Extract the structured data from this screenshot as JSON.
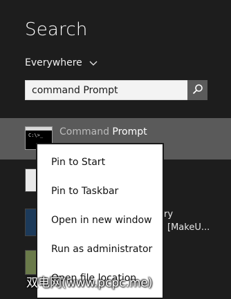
{
  "header": {
    "title": "Search"
  },
  "scope": {
    "label": "Everywhere"
  },
  "search": {
    "value": "command Prompt"
  },
  "results": {
    "first": {
      "prefix": "Command ",
      "match": "Prompt",
      "icon_text": "C:\\>_"
    },
    "partial_right": [
      "ry",
      "[MakeU..."
    ]
  },
  "context_menu": {
    "items": [
      "Pin to Start",
      "Pin to Taskbar",
      "Open in new window",
      "Run as administrator",
      "Open file location"
    ]
  },
  "watermark": {
    "text": "双电网(www.pcpc.me)"
  },
  "colors": {
    "background": "#1d1d1d",
    "selected_result": "#5a5a5a",
    "search_button": "#5b5b5b",
    "menu_bg": "#ffffff"
  }
}
